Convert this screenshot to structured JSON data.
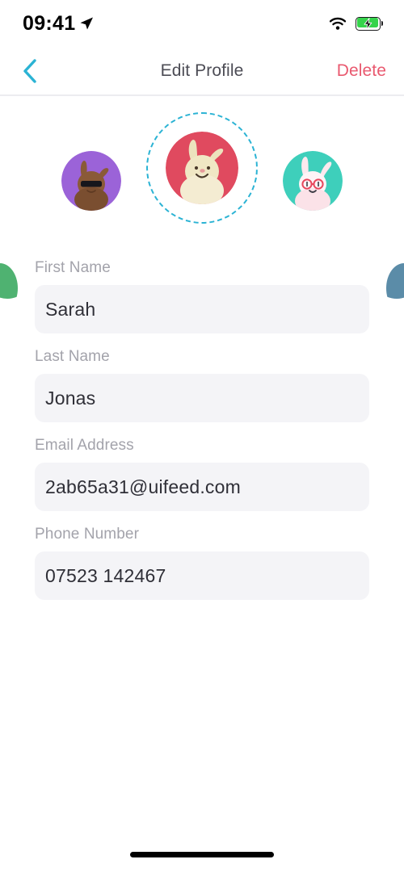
{
  "status_bar": {
    "time": "09:41",
    "location_icon": "location-arrow-icon",
    "wifi_icon": "wifi-icon",
    "battery_icon": "battery-charging-icon",
    "battery_color": "#35d34b"
  },
  "nav": {
    "back_icon": "chevron-left-icon",
    "back_color": "#2bb3d4",
    "title": "Edit Profile",
    "delete_label": "Delete",
    "delete_color": "#e9596f"
  },
  "avatar_carousel": {
    "selected_index": 2,
    "selection_ring_color": "#2bb3d4",
    "items": [
      {
        "name": "avatar-green-partial",
        "bg": "#4fb271",
        "character": "bunny"
      },
      {
        "name": "avatar-purple-sunglasses-bunny",
        "bg": "#9b63d8",
        "character": "brown bunny with sunglasses"
      },
      {
        "name": "avatar-red-cream-bunny",
        "bg": "#e04a5f",
        "character": "cream bunny"
      },
      {
        "name": "avatar-teal-glasses-bunny",
        "bg": "#3ecfbb",
        "character": "white bunny with red glasses"
      },
      {
        "name": "avatar-blue-partial",
        "bg": "#5b8ca8",
        "character": "bunny"
      }
    ]
  },
  "form": {
    "fields": [
      {
        "name": "first-name",
        "label": "First Name",
        "value": "Sarah",
        "placeholder": "First Name"
      },
      {
        "name": "last-name",
        "label": "Last Name",
        "value": "Jonas",
        "placeholder": "Last Name"
      },
      {
        "name": "email-address",
        "label": "Email Address",
        "value": "2ab65a31@uifeed.com",
        "placeholder": "Email Address"
      },
      {
        "name": "phone-number",
        "label": "Phone Number",
        "value": "07523 142467",
        "placeholder": "Phone Number"
      }
    ]
  },
  "home_indicator": {
    "name": "home-indicator"
  }
}
